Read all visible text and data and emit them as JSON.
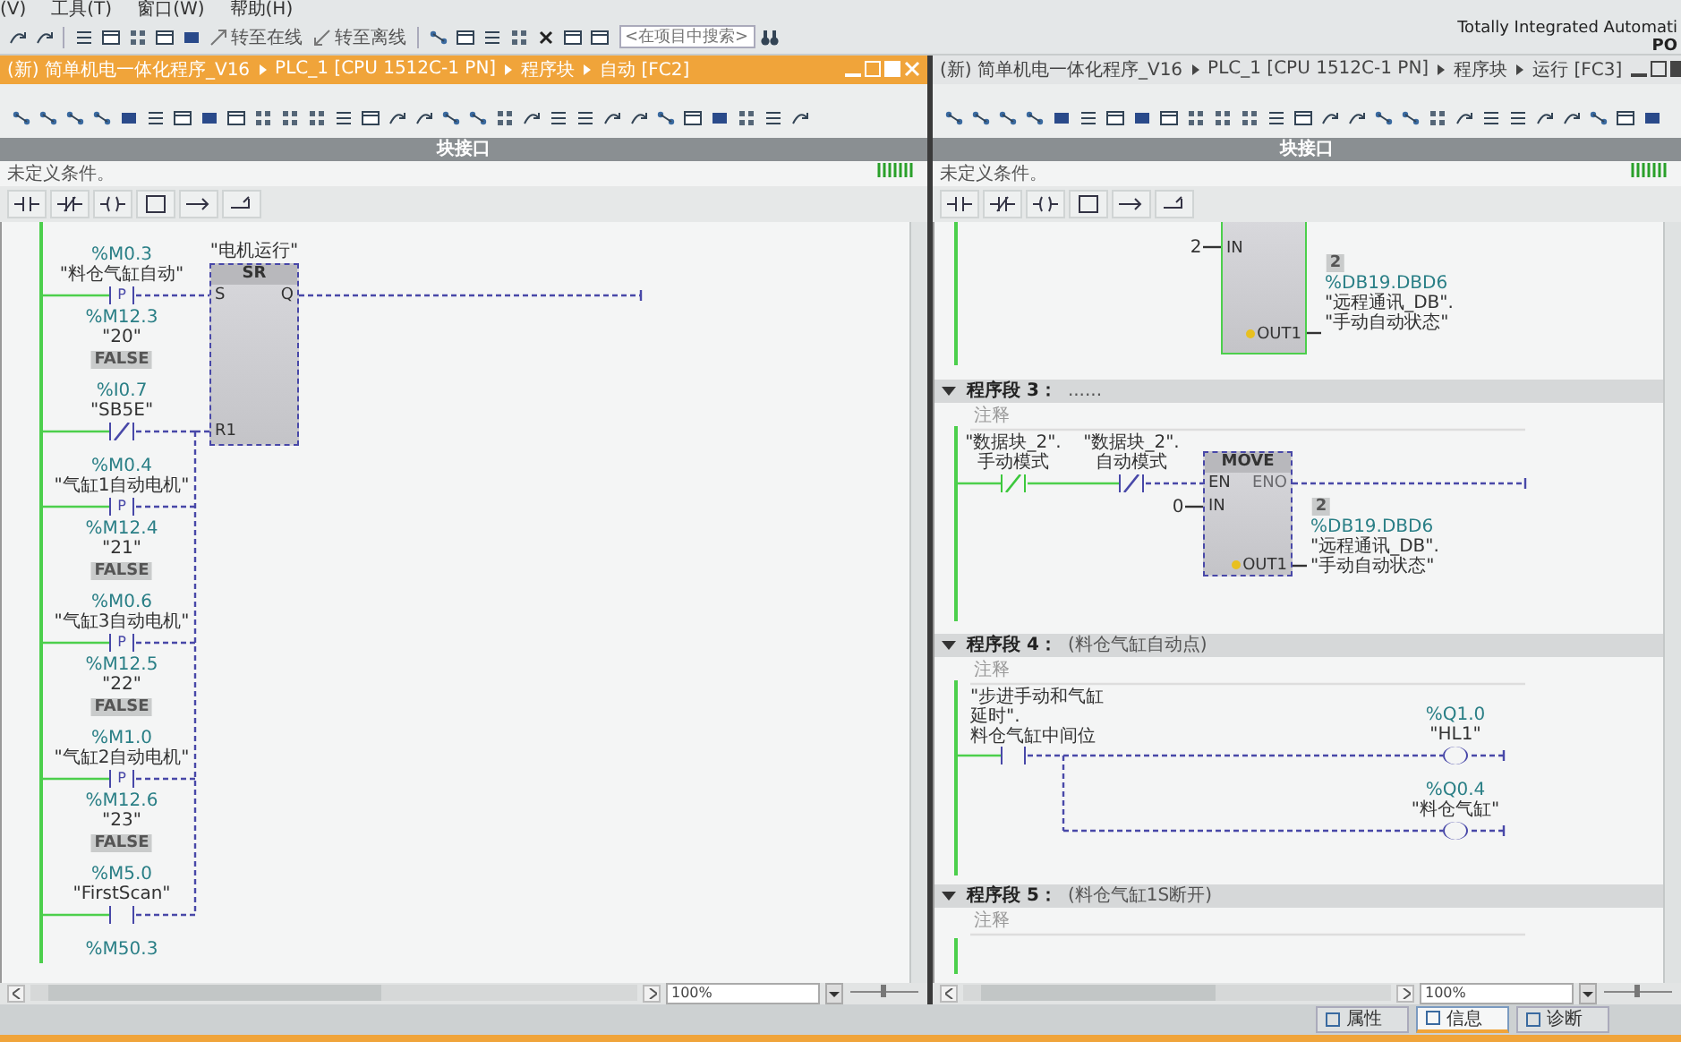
{
  "menu_bar": {
    "items": [
      "(V)",
      "工具(T)",
      "窗口(W)",
      "帮助(H)"
    ]
  },
  "toolbar": {
    "online_button": "转至在线",
    "offline_button": "转至离线",
    "search": {
      "placeholder": "<在项目中搜索>"
    }
  },
  "brand": {
    "title": "Totally Integrated Automati",
    "subtitle": "PO"
  },
  "editors": [
    {
      "active": true,
      "breadcrumb": [
        "(新) 简单机电一体化程序_V16",
        "PLC_1 [CPU 1512C-1 PN]",
        "程序块",
        "自动 [FC2]"
      ],
      "interface_bar": "块接口",
      "condition": "未定义条件。",
      "zoom": "100%",
      "networks": [
        {
          "kind": "sr",
          "block_tag": "\"电机运行\"",
          "block_title": "SR",
          "pins": [
            "S",
            "Q",
            "R1"
          ],
          "contacts": [
            {
              "kind": "p",
              "address": "%M0.3",
              "tag": "\"料仓气缸自动\"",
              "edge_label": "P",
              "edge_address": "%M12.3",
              "edge_tag": "\"20\"",
              "value": "FALSE",
              "powered": false
            },
            {
              "kind": "nc",
              "address": "%I0.7",
              "tag": "\"SB5E\"",
              "powered": false
            },
            {
              "kind": "p",
              "address": "%M0.4",
              "tag": "\"气缸1自动电机\"",
              "edge_label": "P",
              "edge_address": "%M12.4",
              "edge_tag": "\"21\"",
              "value": "FALSE",
              "powered": false
            },
            {
              "kind": "p",
              "address": "%M0.6",
              "tag": "\"气缸3自动电机\"",
              "edge_label": "P",
              "edge_address": "%M12.5",
              "edge_tag": "\"22\"",
              "value": "FALSE",
              "powered": false
            },
            {
              "kind": "p",
              "address": "%M1.0",
              "tag": "\"气缸2自动电机\"",
              "edge_label": "P",
              "edge_address": "%M12.6",
              "edge_tag": "\"23\"",
              "value": "FALSE",
              "powered": false
            },
            {
              "kind": "no",
              "address": "%M5.0",
              "tag": "\"FirstScan\"",
              "powered": false
            },
            {
              "kind": "label",
              "address": "%M50.3"
            }
          ]
        }
      ]
    },
    {
      "active": false,
      "breadcrumb": [
        "(新) 简单机电一体化程序_V16",
        "PLC_1 [CPU 1512C-1 PN]",
        "程序块",
        "运行 [FC3]"
      ],
      "interface_bar": "块接口",
      "condition": "未定义条件。",
      "zoom": "100%",
      "networks": [
        {
          "kind": "move_tail",
          "pins": [
            "IN",
            "OUT1"
          ],
          "in_value": "2",
          "output": [
            "2",
            "%DB19.DBD6",
            "\"远程通讯_DB\".",
            "\"手动自动状态\""
          ]
        },
        {
          "kind": "move",
          "number": "程序段 3：",
          "title": "......",
          "expanded": true,
          "comment": "注释",
          "block_title": "MOVE",
          "pins": [
            "EN",
            "ENO",
            "IN",
            "OUT1"
          ],
          "in_value": "0",
          "output": [
            "2",
            "%DB19.DBD6",
            "\"远程通讯_DB\".",
            "\"手动自动状态\""
          ],
          "contacts": [
            {
              "kind": "nc",
              "tag": "\"数据块_2\".",
              "member": "手动模式",
              "powered": true
            },
            {
              "kind": "nc",
              "tag": "\"数据块_2\".",
              "member": "自动模式",
              "powered": false
            }
          ]
        },
        {
          "kind": "coils",
          "number": "程序段 4：",
          "title": "(料仓气缸自动点)",
          "expanded": true,
          "comment": "注释",
          "contact": {
            "kind": "no",
            "lines": [
              "\"步进手动和气缸",
              "延时\".",
              "料仓气缸中间位"
            ],
            "powered": false
          },
          "coils": [
            {
              "address": "%Q1.0",
              "tag": "\"HL1\""
            },
            {
              "address": "%Q0.4",
              "tag": "\"料仓气缸\""
            }
          ]
        },
        {
          "kind": "empty",
          "number": "程序段 5：",
          "title": "(料仓气缸1S断开)",
          "expanded": true,
          "comment": "注释"
        }
      ]
    }
  ],
  "status_tabs": [
    {
      "label": "属性",
      "selected": false
    },
    {
      "label": "信息",
      "selected": true
    },
    {
      "label": "诊断",
      "selected": false
    }
  ]
}
